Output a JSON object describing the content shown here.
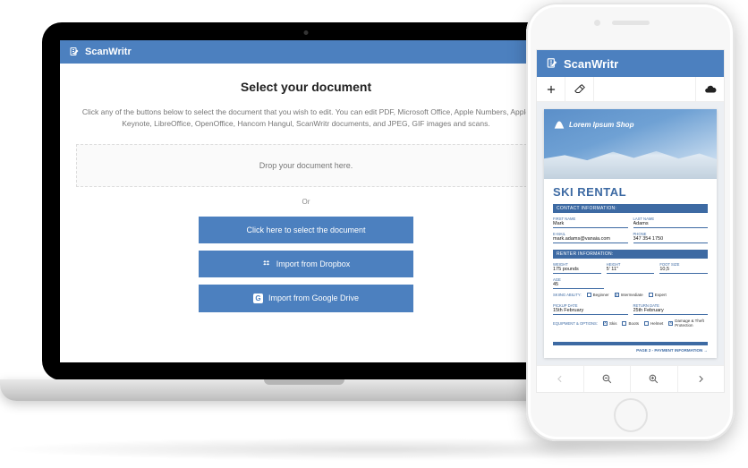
{
  "laptop": {
    "app_title": "ScanWritr",
    "heading": "Select your document",
    "description": "Click any of the buttons below to select the document that you wish to edit. You can edit PDF, Microsoft Office, Apple Numbers, Apple Keynote, LibreOffice, OpenOffice, Hancom Hangul, ScanWritr documents, and JPEG, GIF images and scans.",
    "dropzone_text": "Drop your document here.",
    "or_label": "Or",
    "buttons": {
      "select": "Click here to select the document",
      "dropbox": "Import from Dropbox",
      "gdrive": "Import from Google Drive"
    }
  },
  "phone": {
    "app_title": "ScanWritr",
    "toolbar": {
      "add_icon": "plus-icon",
      "erase_icon": "eraser-icon",
      "cloud_icon": "cloud-upload-icon"
    },
    "bottom_nav": {
      "prev": "chevron-left-icon",
      "zoom_out": "zoom-out-icon",
      "zoom_in": "zoom-in-icon",
      "next": "chevron-right-icon"
    },
    "document": {
      "brand": "Lorem Ipsum Shop",
      "title": "SKI RENTAL",
      "sections": {
        "contact": "CONTACT INFORMATION:",
        "renter": "RENTER  INFORMATION:"
      },
      "fields": {
        "first_name_label": "FIRST NAME",
        "first_name_value": "Mark",
        "last_name_label": "LAST NAME",
        "last_name_value": "Adams",
        "email_label": "E-MAIL",
        "email_value": "mark.adams@vanaia.com",
        "phone_label": "PHONE",
        "phone_value": "347 354 1750",
        "weight_label": "WEIGHT",
        "weight_value": "175 pounds",
        "height_label": "HEIGHT",
        "height_value": "5' 11\"",
        "foot_label": "FOOT SIZE",
        "foot_value": "10,5",
        "age_label": "AGE",
        "age_value": "45",
        "pickup_label": "PICKUP DATE",
        "pickup_value": "15th February",
        "return_label": "RETURN DATE",
        "return_value": "25th February"
      },
      "row_labels": {
        "skiing_ability": "SKIING ABILITY:",
        "equipment": "EQUIPMENT & OPTIONS:"
      },
      "ability_options": {
        "beginner": {
          "label": "Beginner",
          "checked": false
        },
        "intermediate": {
          "label": "Intermediate",
          "checked": true
        },
        "expert": {
          "label": "Expert",
          "checked": false
        }
      },
      "equipment_options": {
        "skis": {
          "label": "Skis",
          "checked": true
        },
        "boots": {
          "label": "Boots",
          "checked": false
        },
        "helmet": {
          "label": "Helmet",
          "checked": false
        },
        "damage": {
          "label": "Damage & Theft Protection",
          "checked": true
        }
      },
      "footer": "PAGE 2 - PAYMENT INFORMATION  →"
    }
  }
}
